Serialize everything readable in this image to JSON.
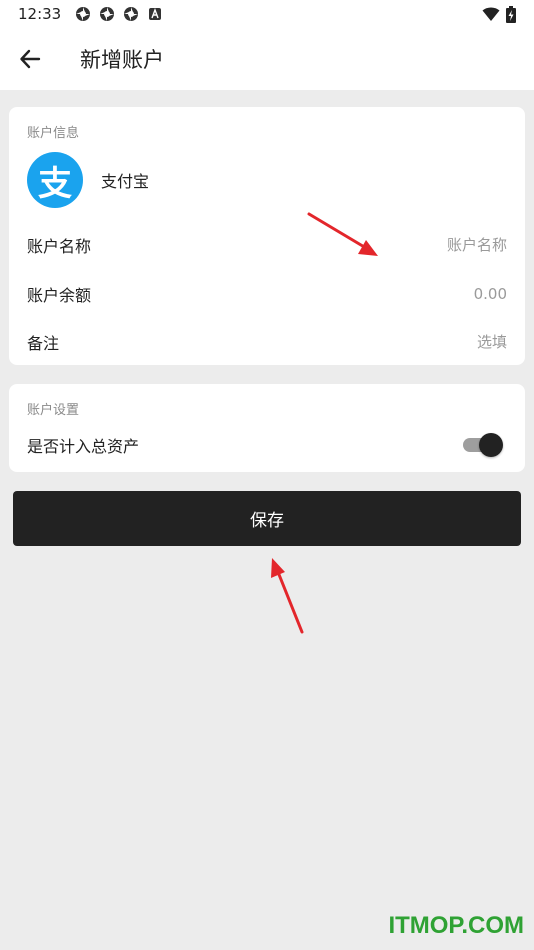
{
  "status_bar": {
    "time": "12:33",
    "icons": [
      "app-icon",
      "app-icon",
      "app-icon",
      "a-icon"
    ],
    "right_icons": [
      "wifi-icon",
      "battery-icon"
    ]
  },
  "app_bar": {
    "back_icon": "back-arrow-icon",
    "title": "新增账户"
  },
  "account_info": {
    "section_label": "账户信息",
    "account_type": {
      "logo_char": "支",
      "name": "支付宝",
      "logo_color": "#1aa3ee"
    },
    "fields": [
      {
        "label": "账户名称",
        "value": "",
        "placeholder": "账户名称"
      },
      {
        "label": "账户余额",
        "value": "",
        "placeholder": "0.00"
      },
      {
        "label": "备注",
        "value": "",
        "placeholder": "选填"
      }
    ]
  },
  "account_settings": {
    "section_label": "账户设置",
    "include_in_total": {
      "label": "是否计入总资产",
      "enabled": true
    }
  },
  "save_button": {
    "label": "保存"
  },
  "watermark": "ITMOP.COM",
  "colors": {
    "background": "#ececec",
    "card": "#ffffff",
    "primary_button": "#222222",
    "annotation_arrow": "#e3262b",
    "watermark": "#2fa234"
  }
}
